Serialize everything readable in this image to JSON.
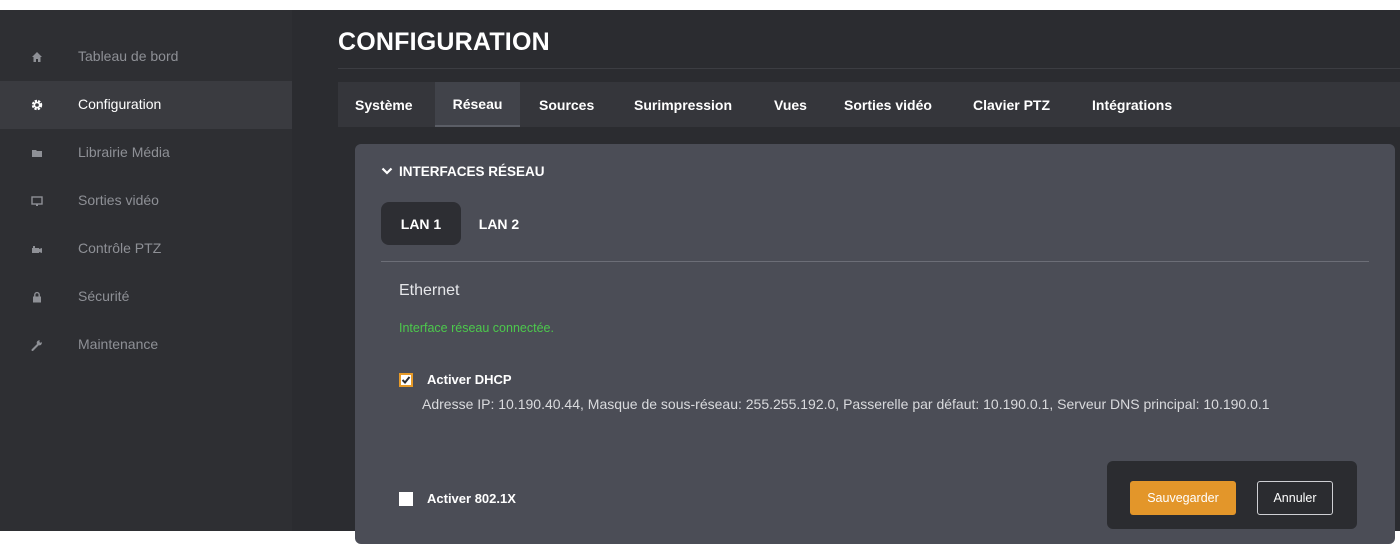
{
  "sidebar": {
    "items": [
      {
        "label": "Tableau de bord",
        "icon": "home-icon",
        "active": false
      },
      {
        "label": "Configuration",
        "icon": "gear-icon",
        "active": true
      },
      {
        "label": "Librairie Média",
        "icon": "folder-icon",
        "active": false
      },
      {
        "label": "Sorties vidéo",
        "icon": "monitor-icon",
        "active": false
      },
      {
        "label": "Contrôle PTZ",
        "icon": "ptz-camera-icon",
        "active": false
      },
      {
        "label": "Sécurité",
        "icon": "lock-icon",
        "active": false
      },
      {
        "label": "Maintenance",
        "icon": "wrench-icon",
        "active": false
      }
    ]
  },
  "header": {
    "title": "CONFIGURATION"
  },
  "tabs": [
    {
      "label": "Système",
      "active": false
    },
    {
      "label": "Réseau",
      "active": true
    },
    {
      "label": "Sources",
      "active": false
    },
    {
      "label": "Surimpression",
      "active": false
    },
    {
      "label": "Vues",
      "active": false
    },
    {
      "label": "Sorties vidéo",
      "active": false
    },
    {
      "label": "Clavier PTZ",
      "active": false
    },
    {
      "label": "Intégrations",
      "active": false
    }
  ],
  "network": {
    "section_title": "INTERFACES RÉSEAU",
    "lan_tabs": [
      {
        "label": "LAN 1",
        "active": true
      },
      {
        "label": "LAN 2",
        "active": false
      }
    ],
    "interface_type": "Ethernet",
    "status": "Interface réseau connectée.",
    "dhcp": {
      "label": "Activer DHCP",
      "checked": true
    },
    "info": "Adresse IP: 10.190.40.44, Masque de sous-réseau: 255.255.192.0, Passerelle par défaut: 10.190.0.1, Serveur DNS principal: 10.190.0.1",
    "dot1x": {
      "label": "Activer 802.1X",
      "checked": false
    }
  },
  "actions": {
    "save_label": "Sauvegarder",
    "cancel_label": "Annuler"
  },
  "colors": {
    "accent": "#e3962a",
    "status_ok": "#4cc94c",
    "sidebar_bg": "#2e2f33",
    "panel_bg": "#4b4d56"
  }
}
